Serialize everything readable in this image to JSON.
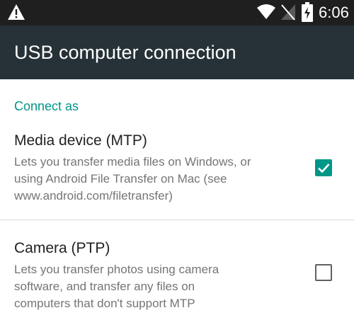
{
  "status_bar": {
    "time": "6:06",
    "icons": [
      "warning-icon",
      "wifi-icon",
      "no-signal-icon",
      "battery-charging-icon"
    ]
  },
  "app_bar": {
    "title": "USB computer connection",
    "background_color": "#263238"
  },
  "section": {
    "header": "Connect as",
    "accent_color": "#009688"
  },
  "options": [
    {
      "title": "Media device (MTP)",
      "description_lines": [
        "Lets you transfer media files on Windows, or",
        "using Android File Transfer on Mac (see",
        "www.android.com/filetransfer)"
      ],
      "checked": true
    },
    {
      "title": "Camera (PTP)",
      "description_lines": [
        "Lets you transfer photos using camera",
        "software, and transfer any files on",
        "computers that don't support MTP"
      ],
      "checked": false
    }
  ]
}
